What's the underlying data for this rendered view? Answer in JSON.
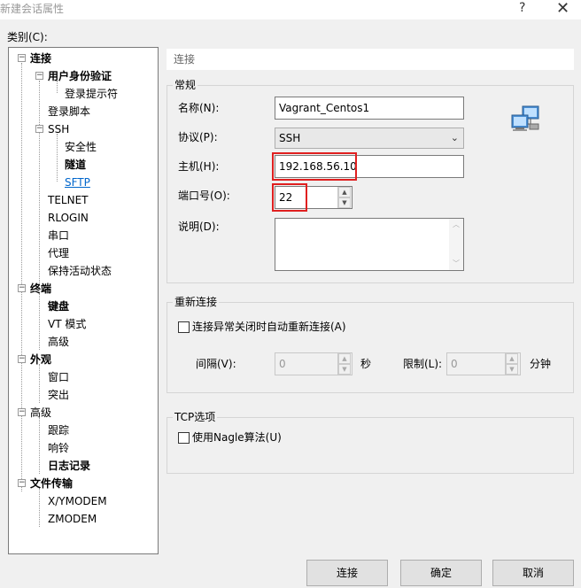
{
  "window": {
    "title": "新建会话属性",
    "help_glyph": "?",
    "close_glyph": "✕"
  },
  "category_label": "类别(C):",
  "tree": [
    {
      "label": "连接",
      "bold": true
    },
    {
      "label": "用户身份验证",
      "bold": true
    },
    {
      "label": "登录提示符",
      "bold": false
    },
    {
      "label": "登录脚本",
      "bold": false
    },
    {
      "label": "SSH",
      "bold": false
    },
    {
      "label": "安全性",
      "bold": false
    },
    {
      "label": "隧道",
      "bold": true
    },
    {
      "label": "SFTP",
      "bold": false,
      "link": true
    },
    {
      "label": "TELNET",
      "bold": false
    },
    {
      "label": "RLOGIN",
      "bold": false
    },
    {
      "label": "串口",
      "bold": false
    },
    {
      "label": "代理",
      "bold": false
    },
    {
      "label": "保持活动状态",
      "bold": false
    },
    {
      "label": "终端",
      "bold": true
    },
    {
      "label": "键盘",
      "bold": true
    },
    {
      "label": "VT 模式",
      "bold": false
    },
    {
      "label": "高级",
      "bold": false
    },
    {
      "label": "外观",
      "bold": true
    },
    {
      "label": "窗口",
      "bold": false
    },
    {
      "label": "突出",
      "bold": false
    },
    {
      "label": "高级",
      "bold": false
    },
    {
      "label": "跟踪",
      "bold": false
    },
    {
      "label": "响铃",
      "bold": false
    },
    {
      "label": "日志记录",
      "bold": true
    },
    {
      "label": "文件传输",
      "bold": true
    },
    {
      "label": "X/YMODEM",
      "bold": false
    },
    {
      "label": "ZMODEM",
      "bold": false
    }
  ],
  "section_header": "连接",
  "general": {
    "title": "常规",
    "name_label": "名称(N):",
    "name_value": "Vagrant_Centos1",
    "protocol_label": "协议(P):",
    "protocol_value": "SSH",
    "host_label": "主机(H):",
    "host_value": "192.168.56.10",
    "port_label": "端口号(O):",
    "port_value": "22",
    "desc_label": "说明(D):",
    "desc_value": ""
  },
  "reconnect": {
    "title": "重新连接",
    "auto_label": "连接异常关闭时自动重新连接(A)",
    "auto_checked": false,
    "interval_label": "间隔(V):",
    "interval_value": "0",
    "interval_unit": "秒",
    "limit_label": "限制(L):",
    "limit_value": "0",
    "limit_unit": "分钟"
  },
  "tcp": {
    "title": "TCP选项",
    "nagle_label": "使用Nagle算法(U)",
    "nagle_checked": false
  },
  "buttons": {
    "connect": "连接",
    "ok": "确定",
    "cancel": "取消"
  },
  "colors": {
    "highlight": "#e02020",
    "link": "#0066cc"
  }
}
